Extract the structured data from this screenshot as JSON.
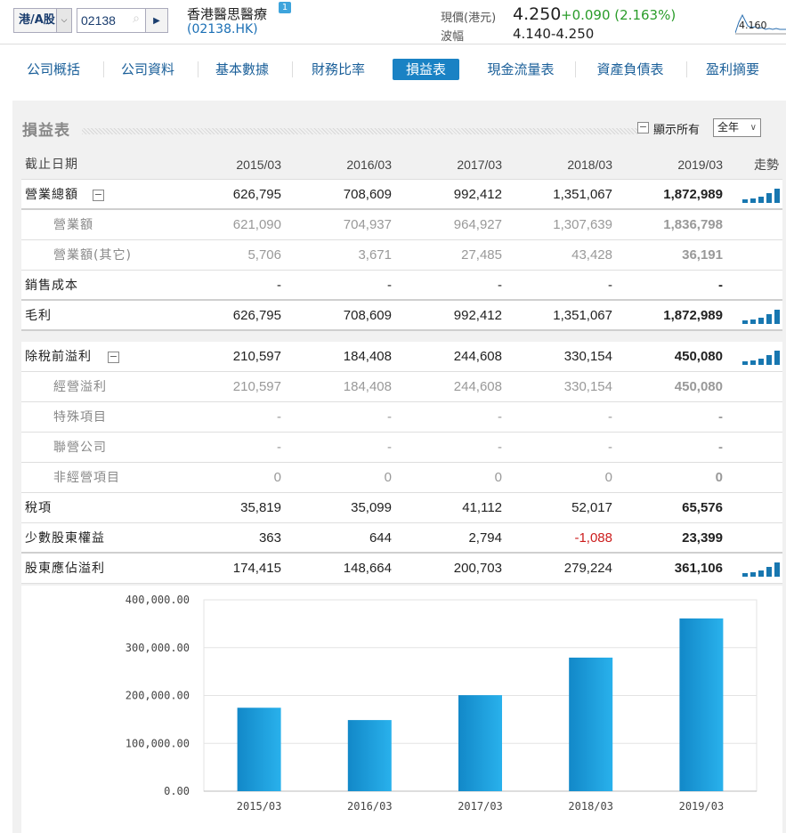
{
  "header": {
    "market_label": "港/A股",
    "code_value": "02138",
    "company_name": "香港醫思醫療",
    "company_badge": "1",
    "company_code": "(02138.HK)",
    "price_label": "現價(港元)",
    "price": "4.250",
    "change": "+0.090 (2.163%)",
    "range_label": "波幅",
    "range": "4.140-4.250",
    "mini_chart_label": "4.160",
    "colors": {
      "up": "#2a9c2a",
      "accent": "#1a82c4",
      "down": "#cc1d1d"
    }
  },
  "tabs": [
    {
      "label": "公司概括"
    },
    {
      "label": "公司資料"
    },
    {
      "label": "基本數據"
    },
    {
      "label": "財務比率"
    },
    {
      "label": "損益表",
      "active": true
    },
    {
      "label": "現金流量表"
    },
    {
      "label": "資產負債表"
    },
    {
      "label": "盈利摘要"
    }
  ],
  "panel": {
    "title": "損益表",
    "show_all_label": "顯示所有",
    "period_value": "全年"
  },
  "table": {
    "header": {
      "label": "截止日期",
      "years": [
        "2015/03",
        "2016/03",
        "2017/03",
        "2018/03",
        "2019/03"
      ],
      "trend": "走勢"
    },
    "rows": [
      {
        "label": "營業總額",
        "values": [
          "626,795",
          "708,609",
          "992,412",
          "1,351,067",
          "1,872,989"
        ],
        "collapse": "−",
        "spark": true
      },
      {
        "label": "營業額",
        "sub": true,
        "values": [
          "621,090",
          "704,937",
          "964,927",
          "1,307,639",
          "1,836,798"
        ]
      },
      {
        "label": "營業額(其它)",
        "sub": true,
        "values": [
          "5,706",
          "3,671",
          "27,485",
          "43,428",
          "36,191"
        ]
      },
      {
        "label": "銷售成本",
        "values": [
          "-",
          "-",
          "-",
          "-",
          "-"
        ]
      },
      {
        "label": "毛利",
        "values": [
          "626,795",
          "708,609",
          "992,412",
          "1,351,067",
          "1,872,989"
        ],
        "spark": true
      },
      {
        "label": "除稅前溢利",
        "values": [
          "210,597",
          "184,408",
          "244,608",
          "330,154",
          "450,080"
        ],
        "collapse": "−",
        "spark": true
      },
      {
        "label": "經營溢利",
        "sub": true,
        "values": [
          "210,597",
          "184,408",
          "244,608",
          "330,154",
          "450,080"
        ]
      },
      {
        "label": "特殊項目",
        "sub": true,
        "values": [
          "-",
          "-",
          "-",
          "-",
          "-"
        ]
      },
      {
        "label": "聯營公司",
        "sub": true,
        "values": [
          "-",
          "-",
          "-",
          "-",
          "-"
        ]
      },
      {
        "label": "非經營項目",
        "sub": true,
        "values": [
          "0",
          "0",
          "0",
          "0",
          "0"
        ]
      },
      {
        "label": "稅項",
        "values": [
          "35,819",
          "35,099",
          "41,112",
          "52,017",
          "65,576"
        ]
      },
      {
        "label": "少數股東權益",
        "values": [
          "363",
          "644",
          "2,794",
          "-1,088",
          "23,399"
        ],
        "negative_index": 3
      },
      {
        "label": "股東應佔溢利",
        "values": [
          "174,415",
          "148,664",
          "200,703",
          "279,224",
          "361,106"
        ],
        "spark": true
      }
    ]
  },
  "chart_data": {
    "type": "bar",
    "categories": [
      "2015/03",
      "2016/03",
      "2017/03",
      "2018/03",
      "2019/03"
    ],
    "values": [
      174415,
      148664,
      200703,
      279224,
      361106
    ],
    "ylim": [
      0,
      400000
    ],
    "yticks": [
      "0.00",
      "100,000.00",
      "200,000.00",
      "300,000.00",
      "400,000.00"
    ],
    "title": "",
    "xlabel": "",
    "ylabel": "",
    "grid": true,
    "bar_color": "#1a9ad8"
  }
}
